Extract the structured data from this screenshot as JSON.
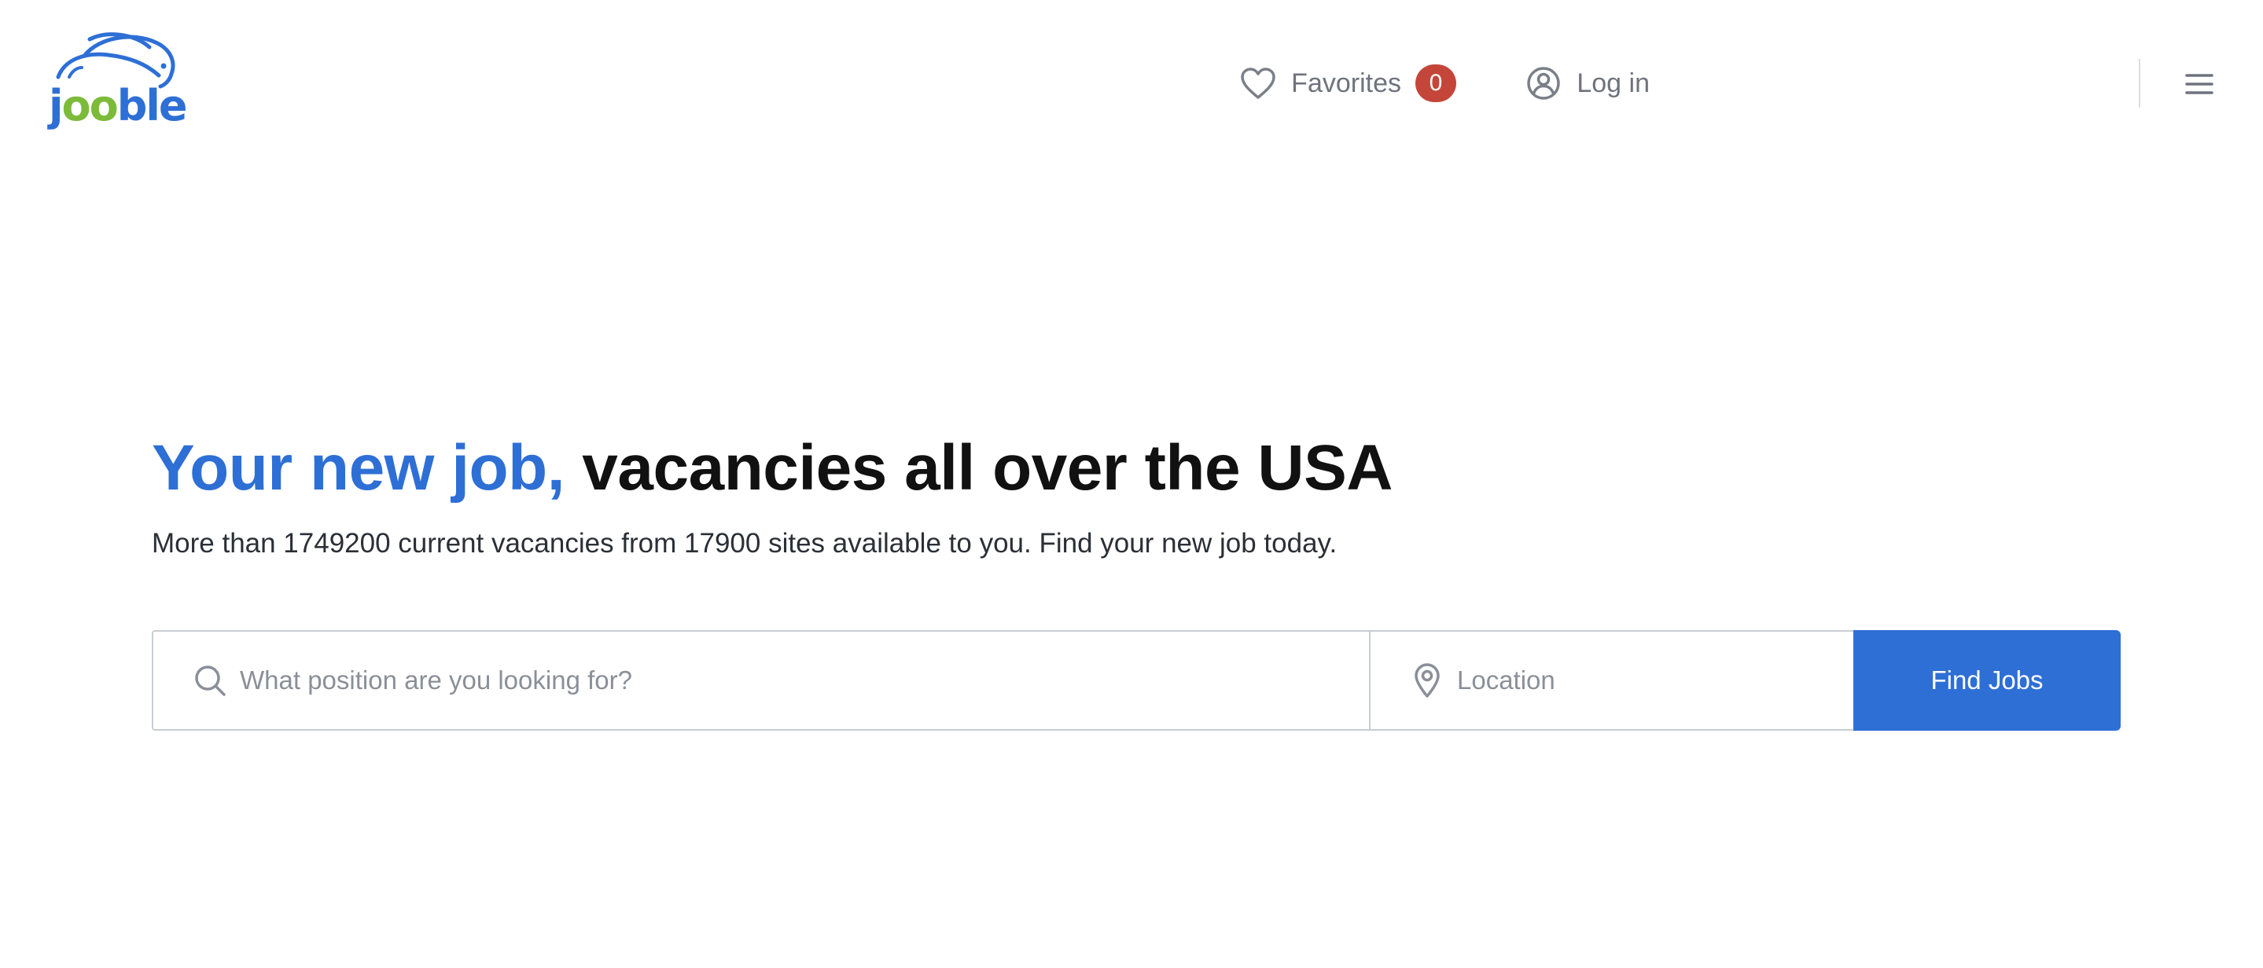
{
  "logo": {
    "word_parts": [
      "j",
      "oo",
      "ble"
    ],
    "brand_blue": "#2e6fd6",
    "brand_green": "#7cbb3a",
    "icon": "rabbit-logo-icon"
  },
  "nav": {
    "favorites_label": "Favorites",
    "favorites_count": "0",
    "favorites_icon": "heart-icon",
    "login_label": "Log in",
    "login_icon": "user-circle-icon",
    "menu_icon": "hamburger-menu-icon",
    "badge_color": "#c4463a"
  },
  "hero": {
    "title_accent": "Your new job,",
    "title_rest": "vacancies all over the USA",
    "subtitle": "More than 1749200 current vacancies from 17900 sites available to you. Find your new job today."
  },
  "search": {
    "position_placeholder": "What position are you looking for?",
    "position_value": "",
    "position_icon": "search-icon",
    "location_placeholder": "Location",
    "location_value": "",
    "location_icon": "location-pin-icon",
    "button_label": "Find Jobs",
    "button_color": "#2e6fd6"
  }
}
